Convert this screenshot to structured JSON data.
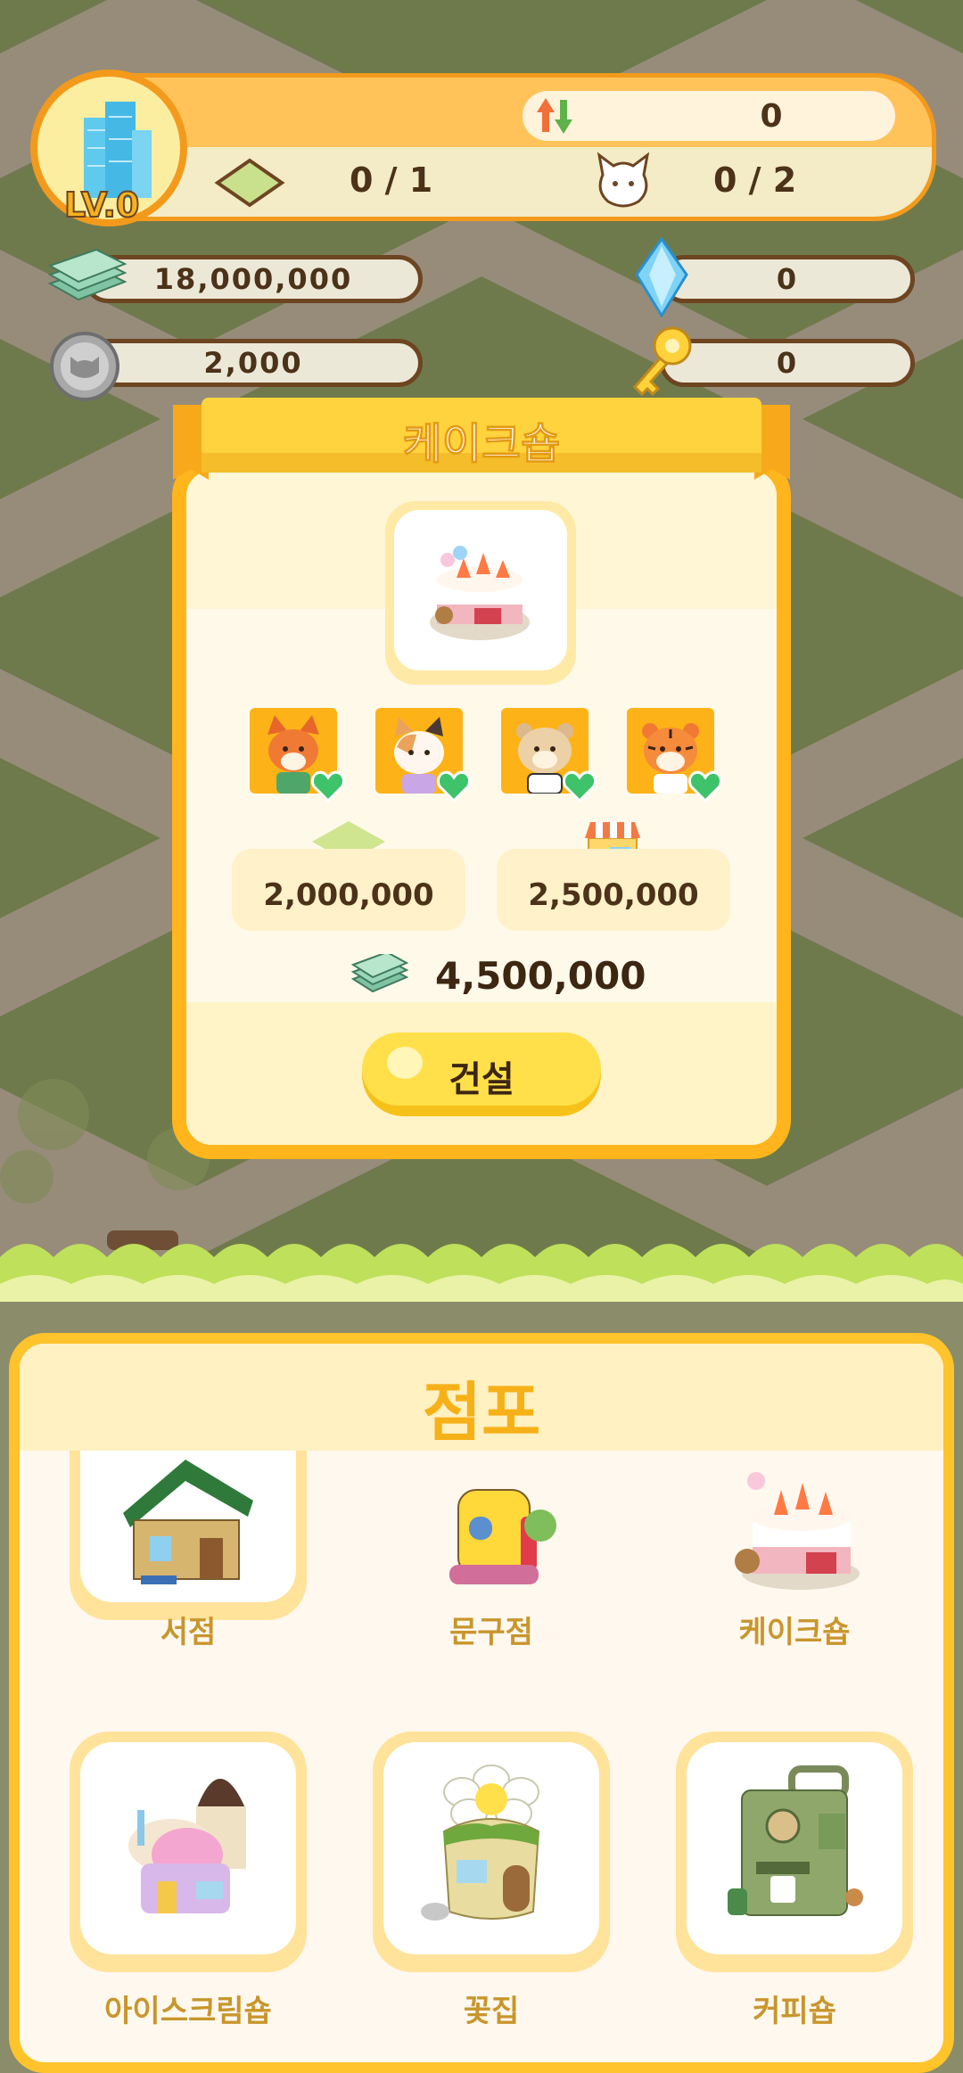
{
  "hud": {
    "level": "LV.0",
    "population": "0",
    "land": "0 / 1",
    "animals": "0 / 2"
  },
  "currencies": {
    "cash": "18,000,000",
    "gem": "0",
    "coin": "2,000",
    "key": "0"
  },
  "build_modal": {
    "title": "케이크숍",
    "land_cost": "2,000,000",
    "building_cost": "2,500,000",
    "total_cost": "4,500,000",
    "build_button": "건설",
    "animal_slots": [
      "fox-icon",
      "calico-cat-icon",
      "hamster-icon",
      "tiger-icon"
    ]
  },
  "shop_panel": {
    "title": "점포",
    "items": [
      {
        "label": "서점",
        "icon": "bookstore-icon"
      },
      {
        "label": "문구점",
        "icon": "stationery-shop-icon"
      },
      {
        "label": "케이크숍",
        "icon": "cake-shop-icon"
      },
      {
        "label": "아이스크림숍",
        "icon": "ice-cream-shop-icon"
      },
      {
        "label": "꽃집",
        "icon": "flower-shop-icon"
      },
      {
        "label": "커피숍",
        "icon": "coffee-shop-icon"
      }
    ]
  },
  "colors": {
    "accent": "#ffb51b",
    "brown": "#6d4521",
    "grass": "#6f7a4c",
    "path": "#978c7a"
  }
}
